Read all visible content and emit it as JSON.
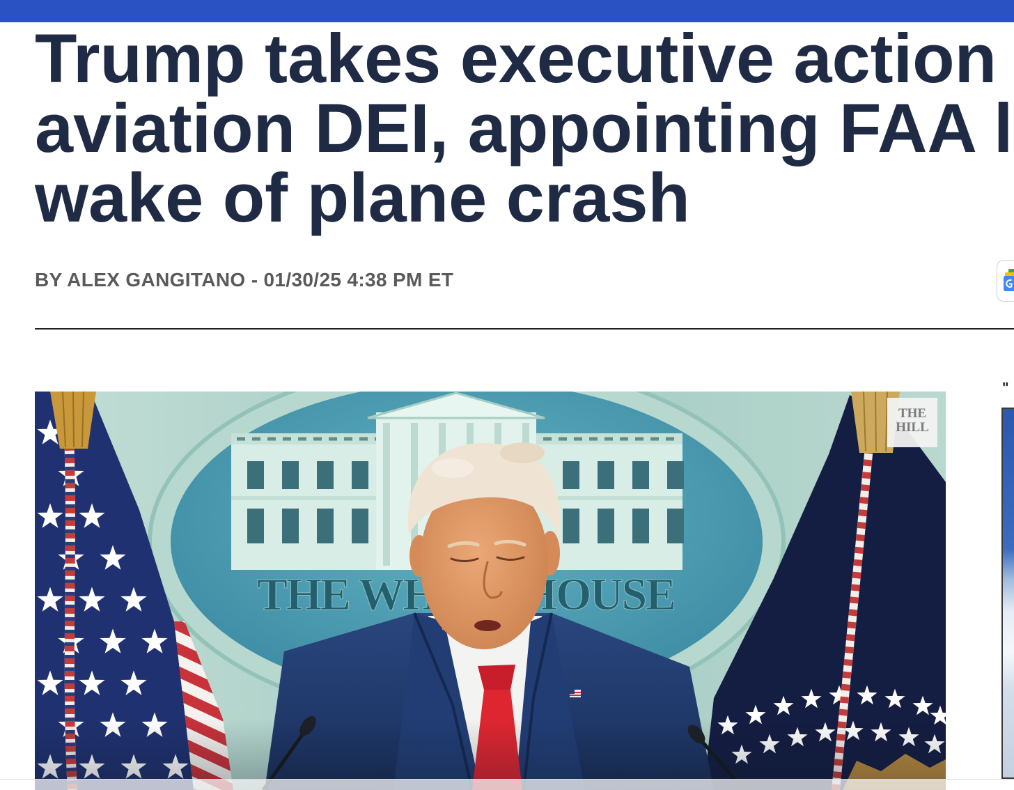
{
  "page": {
    "accent_color": "#2b52c2"
  },
  "article": {
    "headline": {
      "lines": [
        "Trump takes executive action",
        "aviation DEI, appointing FAA l",
        "wake of plane crash"
      ],
      "color": "#1f2a44"
    },
    "byline": {
      "text": "BY ALEX GANGITANO - 01/30/25 4:38 PM ET",
      "color": "#5a5a5a"
    },
    "share_button": {
      "icon": "google-news-icon"
    },
    "hero_image": {
      "seal_text": "THE WHITE HOUSE",
      "watermark_lines": [
        "THE",
        "HILL"
      ]
    }
  },
  "sidebar": {
    "quote_mark": "\""
  }
}
